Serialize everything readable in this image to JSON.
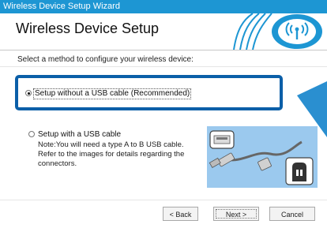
{
  "window": {
    "title": "Wireless Device Setup Wizard"
  },
  "header": {
    "title": "Wireless Device Setup"
  },
  "main": {
    "prompt": "Select a method to configure your wireless device:",
    "options": [
      {
        "label": "Setup without a USB cable (Recommended)",
        "selected": true
      },
      {
        "label": "Setup with a USB cable",
        "selected": false,
        "note": "Note:You will need a type A to B USB cable. Refer to the images for details regarding the connectors."
      }
    ]
  },
  "buttons": {
    "back": "< Back",
    "next": "Next >",
    "cancel": "Cancel"
  },
  "colors": {
    "titlebar": "#1d96d3",
    "highlight": "#0b5fa8",
    "arrow": "#2a8fd0"
  },
  "icons": [
    "wireless-logo-icon",
    "callout-arrow-icon",
    "usb-cable-illustration"
  ]
}
